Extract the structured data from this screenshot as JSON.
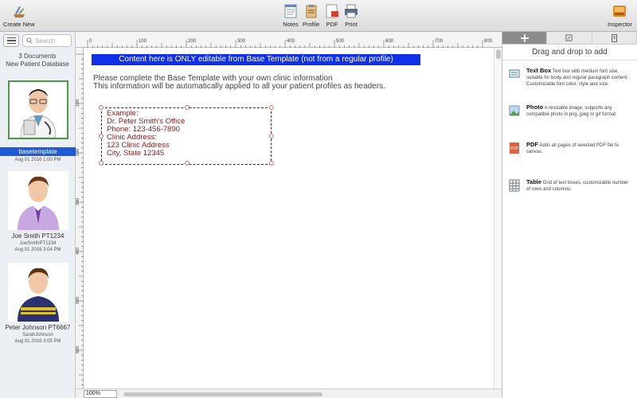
{
  "toolbar": {
    "create_new": "Create New",
    "notes": "Notes",
    "profile": "Profile",
    "pdf": "PDF",
    "print": "Print",
    "inspector": "Inspector"
  },
  "sidebar": {
    "search_placeholder": "Search",
    "doc_count": "3 Documents",
    "database": "New Patient Database",
    "patients": [
      {
        "name": "basetemplate",
        "sub": "",
        "date": "Aug 01 2016 1:00 PM"
      },
      {
        "name": "Joe Smith PT1234",
        "sub": "JoeSmithPT1234",
        "date": "Aug 01 2016 3:04 PM"
      },
      {
        "name": "Peter Johnson PT6667",
        "sub": "SarahJohnson",
        "date": "Aug 01 2016 3:05 PM"
      }
    ]
  },
  "ruler": {
    "top": [
      "0",
      "100",
      "200",
      "300",
      "400",
      "500",
      "600",
      "700",
      "800"
    ],
    "left": [
      "100",
      "200",
      "300",
      "400",
      "500",
      "600"
    ]
  },
  "canvas": {
    "banner": "Content here is ONLY editable from Base Template (not from a regular profile)",
    "info_line1": "Please complete the Base Template with your own clinic information",
    "info_line2": "This information will be automatically applied to all your patient profiles as headers.",
    "textbox": "Example:\nDr. Peter Smith's Office\nPhone: 123-456-7890\nClinic Address:\n123 Clinic Address\nCity, State 12345",
    "zoom": "100%"
  },
  "inspector": {
    "title": "Drag and drop to add",
    "items": [
      {
        "name": "Text Box",
        "desc": "Text box with medium font size, suitable for body and regular paragraph content. Customizable font color, style and size."
      },
      {
        "name": "Photo",
        "desc": "A resizable image, supports any compatible photo in png, jpeg or gif format."
      },
      {
        "name": "PDF",
        "desc": "Adds all pages of selected PDF file to canvas."
      },
      {
        "name": "Table",
        "desc": "Grid of text boxes, customizable number of rows and columns."
      }
    ]
  },
  "colors": {
    "banner_bg": "#1030e8",
    "selection_blue": "#1e5bd7",
    "textbox_text": "#8a1a1a",
    "selected_border": "#4a9a45"
  }
}
